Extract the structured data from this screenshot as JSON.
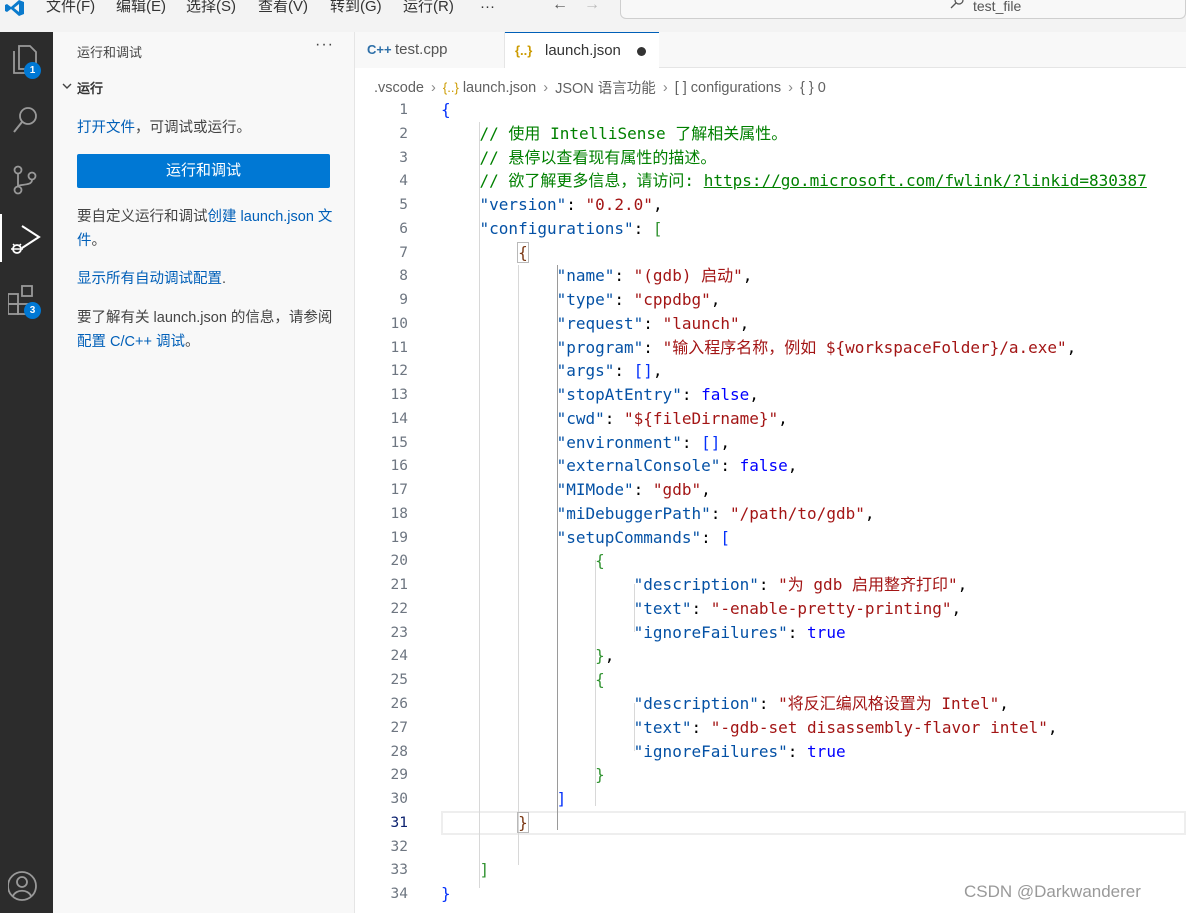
{
  "menu": [
    "文件(F)",
    "编辑(E)",
    "选择(S)",
    "查看(V)",
    "转到(G)",
    "运行(R)",
    "···"
  ],
  "command_center": "test_file",
  "activity_badges": {
    "explorer": "1",
    "extensions": "3"
  },
  "sidebar": {
    "title": "运行和调试",
    "more": "···",
    "section": "运行",
    "open_file_link": "打开文件",
    "open_file_rest": "，可调试或运行。",
    "button": "运行和调试",
    "customize_prefix": "要自定义运行和调试",
    "customize_link": "创建 launch.json 文件",
    "customize_suffix": "。",
    "show_auto": "显示所有自动调试配置",
    "show_auto_suffix": ".",
    "learn_prefix": "要了解有关 launch.json 的信息，请参阅 ",
    "learn_link": "配置 C/C++ 调试",
    "learn_suffix": "。"
  },
  "tabs": [
    {
      "icon": "C++",
      "label": "test.cpp"
    },
    {
      "icon": "{..}",
      "label": "launch.json"
    }
  ],
  "breadcrumb": [
    ".vscode",
    "launch.json",
    "JSON 语言功能",
    "[ ] configurations",
    "{ } 0"
  ],
  "code": {
    "c1": "// 使用 IntelliSense 了解相关属性。",
    "c2": "// 悬停以查看现有属性的描述。",
    "c3": "// 欲了解更多信息，请访问: ",
    "c3_link": "https://go.microsoft.com/fwlink/?linkid=830387",
    "version_key": "\"version\"",
    "version_val": "\"0.2.0\"",
    "configurations_key": "\"configurations\"",
    "name_key": "\"name\"",
    "name_val": "\"(gdb) 启动\"",
    "type_key": "\"type\"",
    "type_val": "\"cppdbg\"",
    "request_key": "\"request\"",
    "request_val": "\"launch\"",
    "program_key": "\"program\"",
    "program_val": "\"输入程序名称，例如 ${workspaceFolder}/a.exe\"",
    "args_key": "\"args\"",
    "stop_key": "\"stopAtEntry\"",
    "false": "false",
    "true": "true",
    "cwd_key": "\"cwd\"",
    "cwd_val": "\"${fileDirname}\"",
    "env_key": "\"environment\"",
    "ext_key": "\"externalConsole\"",
    "mimode_key": "\"MIMode\"",
    "mimode_val": "\"gdb\"",
    "midbg_key": "\"miDebuggerPath\"",
    "midbg_val": "\"/path/to/gdb\"",
    "setup_key": "\"setupCommands\"",
    "desc_key": "\"description\"",
    "desc1_val": "\"为 gdb 启用整齐打印\"",
    "desc2_val": "\"将反汇编风格设置为 Intel\"",
    "text_key": "\"text\"",
    "text1_val": "\"-enable-pretty-printing\"",
    "text2_val": "\"-gdb-set disassembly-flavor intel\"",
    "ignore_key": "\"ignoreFailures\""
  },
  "watermark": "CSDN @Darkwanderer"
}
